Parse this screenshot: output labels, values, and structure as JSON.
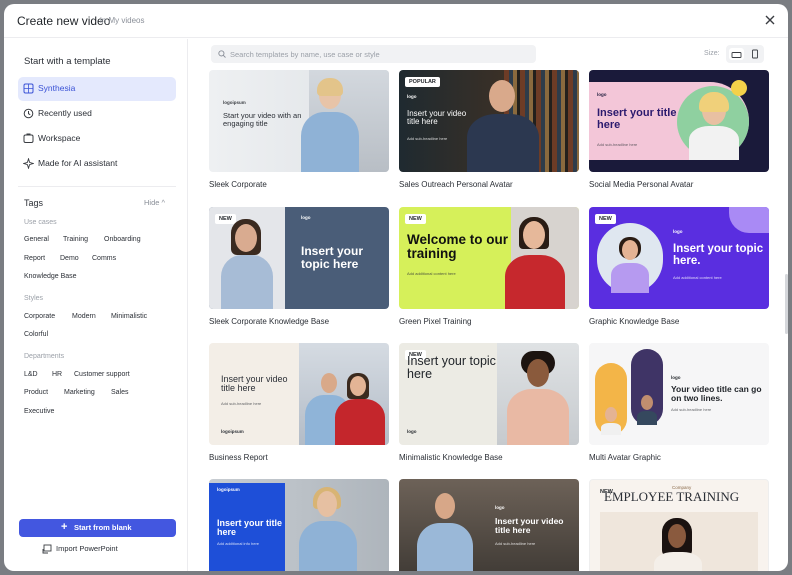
{
  "header": {
    "title": "Create new video",
    "subtitle": "in My videos"
  },
  "sidebar": {
    "heading": "Start with a template",
    "nav": [
      {
        "label": "Synthesia",
        "icon": "grid-icon",
        "active": true
      },
      {
        "label": "Recently used",
        "icon": "clock-icon"
      },
      {
        "label": "Workspace",
        "icon": "workspace-icon"
      },
      {
        "label": "Made for AI assistant",
        "icon": "sparkle-icon"
      }
    ],
    "tags_heading": "Tags",
    "hide_label": "Hide",
    "groups": [
      {
        "label": "Use cases",
        "chips": [
          "General",
          "Training",
          "Onboarding",
          "Report",
          "Demo",
          "Comms",
          "Knowledge Base"
        ]
      },
      {
        "label": "Styles",
        "chips": [
          "Corporate",
          "Modern",
          "Minimalistic",
          "Colorful"
        ]
      },
      {
        "label": "Departments",
        "chips": [
          "L&D",
          "HR",
          "Customer support",
          "Product",
          "Marketing",
          "Sales",
          "Executive"
        ]
      }
    ],
    "start_blank": "Start from blank",
    "import": "Import PowerPoint"
  },
  "search": {
    "placeholder": "Search templates by name, use case or style"
  },
  "size_label": "Size:",
  "templates": [
    {
      "name": "Sleek Corporate",
      "badge": "",
      "title": "Start your video with an engaging title",
      "logo": "logoipsum"
    },
    {
      "name": "Sales Outreach Personal Avatar",
      "badge": "POPULAR",
      "title": "Insert your video title here",
      "logo": "logo",
      "sub": "Add sub-headline here"
    },
    {
      "name": "Social Media Personal Avatar",
      "badge": "",
      "title": "Insert your title here",
      "logo": "logo",
      "sub": "Add sub-headline here"
    },
    {
      "name": "Sleek Corporate Knowledge Base",
      "badge": "NEW",
      "title": "Insert your topic here",
      "logo": "logo"
    },
    {
      "name": "Green Pixel Training",
      "badge": "NEW",
      "title": "Welcome to our training",
      "sub": "Add additional content here"
    },
    {
      "name": "Graphic Knowledge Base",
      "badge": "NEW",
      "title": "Insert your topic here.",
      "logo": "logo",
      "sub": "Add additional content here"
    },
    {
      "name": "Business Report",
      "badge": "",
      "title": "Insert your video title here",
      "logo": "logoipsum",
      "sub": "Add sub-headline here"
    },
    {
      "name": "Minimalistic Knowledge Base",
      "badge": "NEW",
      "title": "Insert your topic here",
      "logo": "logo"
    },
    {
      "name": "Multi Avatar Graphic",
      "badge": "",
      "title": "Your video title can go on two lines.",
      "logo": "logo",
      "sub": "Add sub-headline here"
    },
    {
      "name": "",
      "badge": "",
      "title": "Insert your title here",
      "logo": "logoipsum",
      "sub": "Add additional info here"
    },
    {
      "name": "",
      "badge": "",
      "title": "Insert your video title here",
      "logo": "logo",
      "sub": "Add sub-headline here"
    },
    {
      "name": "",
      "badge": "NEW",
      "title": "EMPLOYEE TRAINING",
      "logo": "Company"
    }
  ]
}
